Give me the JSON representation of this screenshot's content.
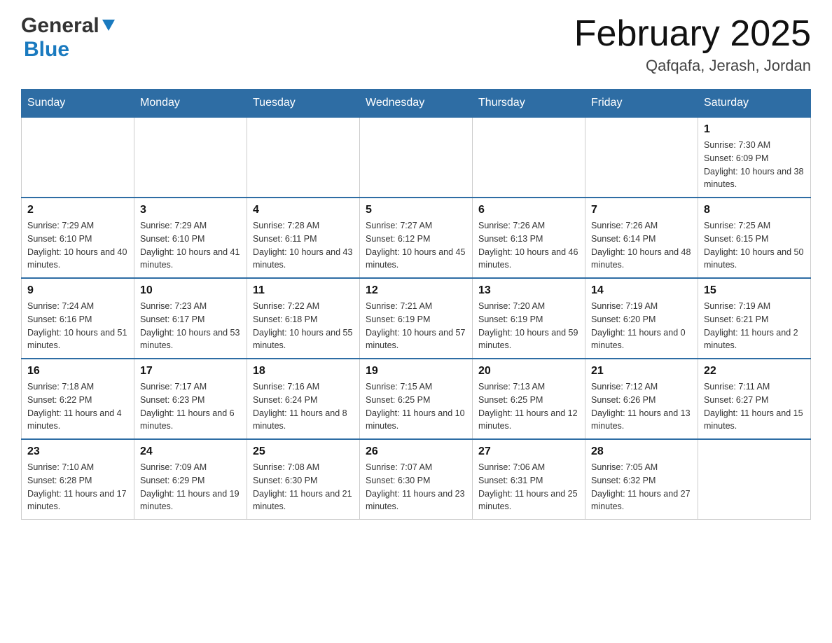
{
  "header": {
    "logo_general": "General",
    "logo_blue": "Blue",
    "month_title": "February 2025",
    "location": "Qafqafa, Jerash, Jordan"
  },
  "days_of_week": [
    "Sunday",
    "Monday",
    "Tuesday",
    "Wednesday",
    "Thursday",
    "Friday",
    "Saturday"
  ],
  "weeks": [
    [
      {
        "day": "",
        "info": ""
      },
      {
        "day": "",
        "info": ""
      },
      {
        "day": "",
        "info": ""
      },
      {
        "day": "",
        "info": ""
      },
      {
        "day": "",
        "info": ""
      },
      {
        "day": "",
        "info": ""
      },
      {
        "day": "1",
        "info": "Sunrise: 7:30 AM\nSunset: 6:09 PM\nDaylight: 10 hours and 38 minutes."
      }
    ],
    [
      {
        "day": "2",
        "info": "Sunrise: 7:29 AM\nSunset: 6:10 PM\nDaylight: 10 hours and 40 minutes."
      },
      {
        "day": "3",
        "info": "Sunrise: 7:29 AM\nSunset: 6:10 PM\nDaylight: 10 hours and 41 minutes."
      },
      {
        "day": "4",
        "info": "Sunrise: 7:28 AM\nSunset: 6:11 PM\nDaylight: 10 hours and 43 minutes."
      },
      {
        "day": "5",
        "info": "Sunrise: 7:27 AM\nSunset: 6:12 PM\nDaylight: 10 hours and 45 minutes."
      },
      {
        "day": "6",
        "info": "Sunrise: 7:26 AM\nSunset: 6:13 PM\nDaylight: 10 hours and 46 minutes."
      },
      {
        "day": "7",
        "info": "Sunrise: 7:26 AM\nSunset: 6:14 PM\nDaylight: 10 hours and 48 minutes."
      },
      {
        "day": "8",
        "info": "Sunrise: 7:25 AM\nSunset: 6:15 PM\nDaylight: 10 hours and 50 minutes."
      }
    ],
    [
      {
        "day": "9",
        "info": "Sunrise: 7:24 AM\nSunset: 6:16 PM\nDaylight: 10 hours and 51 minutes."
      },
      {
        "day": "10",
        "info": "Sunrise: 7:23 AM\nSunset: 6:17 PM\nDaylight: 10 hours and 53 minutes."
      },
      {
        "day": "11",
        "info": "Sunrise: 7:22 AM\nSunset: 6:18 PM\nDaylight: 10 hours and 55 minutes."
      },
      {
        "day": "12",
        "info": "Sunrise: 7:21 AM\nSunset: 6:19 PM\nDaylight: 10 hours and 57 minutes."
      },
      {
        "day": "13",
        "info": "Sunrise: 7:20 AM\nSunset: 6:19 PM\nDaylight: 10 hours and 59 minutes."
      },
      {
        "day": "14",
        "info": "Sunrise: 7:19 AM\nSunset: 6:20 PM\nDaylight: 11 hours and 0 minutes."
      },
      {
        "day": "15",
        "info": "Sunrise: 7:19 AM\nSunset: 6:21 PM\nDaylight: 11 hours and 2 minutes."
      }
    ],
    [
      {
        "day": "16",
        "info": "Sunrise: 7:18 AM\nSunset: 6:22 PM\nDaylight: 11 hours and 4 minutes."
      },
      {
        "day": "17",
        "info": "Sunrise: 7:17 AM\nSunset: 6:23 PM\nDaylight: 11 hours and 6 minutes."
      },
      {
        "day": "18",
        "info": "Sunrise: 7:16 AM\nSunset: 6:24 PM\nDaylight: 11 hours and 8 minutes."
      },
      {
        "day": "19",
        "info": "Sunrise: 7:15 AM\nSunset: 6:25 PM\nDaylight: 11 hours and 10 minutes."
      },
      {
        "day": "20",
        "info": "Sunrise: 7:13 AM\nSunset: 6:25 PM\nDaylight: 11 hours and 12 minutes."
      },
      {
        "day": "21",
        "info": "Sunrise: 7:12 AM\nSunset: 6:26 PM\nDaylight: 11 hours and 13 minutes."
      },
      {
        "day": "22",
        "info": "Sunrise: 7:11 AM\nSunset: 6:27 PM\nDaylight: 11 hours and 15 minutes."
      }
    ],
    [
      {
        "day": "23",
        "info": "Sunrise: 7:10 AM\nSunset: 6:28 PM\nDaylight: 11 hours and 17 minutes."
      },
      {
        "day": "24",
        "info": "Sunrise: 7:09 AM\nSunset: 6:29 PM\nDaylight: 11 hours and 19 minutes."
      },
      {
        "day": "25",
        "info": "Sunrise: 7:08 AM\nSunset: 6:30 PM\nDaylight: 11 hours and 21 minutes."
      },
      {
        "day": "26",
        "info": "Sunrise: 7:07 AM\nSunset: 6:30 PM\nDaylight: 11 hours and 23 minutes."
      },
      {
        "day": "27",
        "info": "Sunrise: 7:06 AM\nSunset: 6:31 PM\nDaylight: 11 hours and 25 minutes."
      },
      {
        "day": "28",
        "info": "Sunrise: 7:05 AM\nSunset: 6:32 PM\nDaylight: 11 hours and 27 minutes."
      },
      {
        "day": "",
        "info": ""
      }
    ]
  ]
}
